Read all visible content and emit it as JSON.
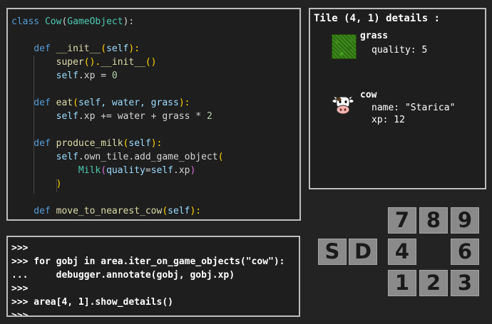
{
  "code_editor": {
    "lines": [
      [
        {
          "t": "class ",
          "c": "kw"
        },
        {
          "t": "Cow",
          "c": "cls"
        },
        {
          "t": "(",
          "c": ""
        },
        {
          "t": "GameObject",
          "c": "cls"
        },
        {
          "t": "):",
          "c": ""
        }
      ],
      [],
      [
        {
          "t": "    def ",
          "c": "kw"
        },
        {
          "t": "__init__",
          "c": "fn"
        },
        {
          "t": "(",
          "c": "br1"
        },
        {
          "t": "self",
          "c": "self"
        },
        {
          "t": "):",
          "c": "br1"
        }
      ],
      [
        {
          "t": "        super",
          "c": "fn"
        },
        {
          "t": "().",
          "c": "br1"
        },
        {
          "t": "__init__",
          "c": "fn"
        },
        {
          "t": "()",
          "c": "br1"
        }
      ],
      [
        {
          "t": "        self",
          "c": "self"
        },
        {
          "t": ".xp = ",
          "c": ""
        },
        {
          "t": "0",
          "c": "num"
        }
      ],
      [],
      [
        {
          "t": "    def ",
          "c": "kw"
        },
        {
          "t": "eat",
          "c": "fn"
        },
        {
          "t": "(",
          "c": "br1"
        },
        {
          "t": "self, water, grass",
          "c": "self"
        },
        {
          "t": "):",
          "c": "br1"
        }
      ],
      [
        {
          "t": "        self",
          "c": "self"
        },
        {
          "t": ".xp += water + grass * ",
          "c": ""
        },
        {
          "t": "2",
          "c": "num"
        }
      ],
      [],
      [
        {
          "t": "    def ",
          "c": "kw"
        },
        {
          "t": "produce_milk",
          "c": "fn"
        },
        {
          "t": "(",
          "c": "br1"
        },
        {
          "t": "self",
          "c": "self"
        },
        {
          "t": "):",
          "c": "br1"
        }
      ],
      [
        {
          "t": "        self",
          "c": "self"
        },
        {
          "t": ".own_tile.add_game_object",
          "c": ""
        },
        {
          "t": "(",
          "c": "br1"
        }
      ],
      [
        {
          "t": "            Milk",
          "c": "cls"
        },
        {
          "t": "(",
          "c": "br2"
        },
        {
          "t": "quality",
          "c": "self"
        },
        {
          "t": "=",
          "c": ""
        },
        {
          "t": "self",
          "c": "self"
        },
        {
          "t": ".xp",
          "c": ""
        },
        {
          "t": ")",
          "c": "br2"
        }
      ],
      [
        {
          "t": "        )",
          "c": "br1"
        }
      ],
      [],
      [
        {
          "t": "    def ",
          "c": "kw"
        },
        {
          "t": "move_to_nearest_cow",
          "c": "fn"
        },
        {
          "t": "(",
          "c": "br1"
        },
        {
          "t": "self",
          "c": "self"
        },
        {
          "t": "):",
          "c": "br1"
        }
      ]
    ]
  },
  "console": {
    "lines": [
      ">>>",
      ">>> for gobj in area.iter_on_game_objects(\"cow\"):",
      "...     debugger.annotate(gobj, gobj.xp)",
      ">>>",
      ">>> area[4, 1].show_details()",
      ">>>"
    ]
  },
  "details": {
    "title": "Tile (4, 1) details :",
    "grass": {
      "name": "grass",
      "quality": "quality: 5"
    },
    "cow": {
      "name": "cow",
      "name_attr": "name: \"Starica\"",
      "xp": "xp: 12"
    }
  },
  "keys": {
    "s": "S",
    "d": "D",
    "k7": "7",
    "k8": "8",
    "k9": "9",
    "k4": "4",
    "k6": "6",
    "k1": "1",
    "k2": "2",
    "k3": "3"
  }
}
